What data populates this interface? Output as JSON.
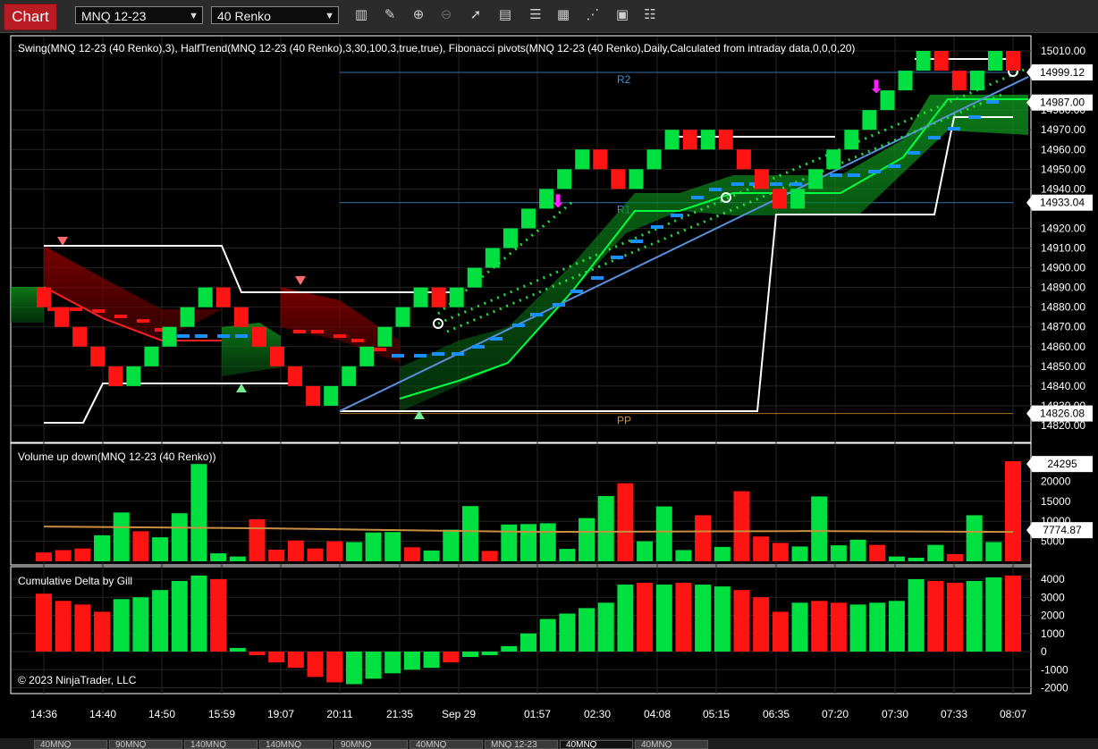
{
  "window": {
    "tab_label": "Chart",
    "instrument": "MNQ 12-23",
    "period": "40 Renko"
  },
  "toolbar_icons": [
    "bar-type-icon",
    "draw-pencil-icon",
    "zoom-in-icon",
    "zoom-out-icon",
    "pointer-icon",
    "data-box-icon",
    "properties-icon",
    "indicators-icon",
    "strategies-icon",
    "templates-icon",
    "list-icon"
  ],
  "panels": {
    "price": {
      "label": "Swing(MNQ 12-23 (40 Renko),3), HalfTrend(MNQ 12-23 (40 Renko),3,30,100,3,true,true), Fibonacci pivots(MNQ 12-23 (40 Renko),Daily,Calculated from intraday data,0,0,0,20)",
      "ticks": [
        "15010.00",
        "14980.00",
        "14970.00",
        "14960.00",
        "14950.00",
        "14940.00",
        "14920.00",
        "14910.00",
        "14900.00",
        "14890.00",
        "14880.00",
        "14870.00",
        "14860.00",
        "14850.00",
        "14840.00",
        "14830.00",
        "14820.00"
      ],
      "price_flags": [
        {
          "text": "14999.12",
          "color": "#ffffff",
          "value": 14999.12
        },
        {
          "text": "14987.00",
          "color": "#ffffff",
          "value": 14987.0
        },
        {
          "text": "14933.04",
          "color": "#ffffff",
          "value": 14933.04
        },
        {
          "text": "14826.08",
          "color": "#ffffff",
          "value": 14826.08
        }
      ],
      "pivot_labels": [
        {
          "text": "R2",
          "color": "#3f8fd8",
          "value": 14999.12
        },
        {
          "text": "R1",
          "color": "#3f8fd8",
          "value": 14933.04
        },
        {
          "text": "PP",
          "color": "#d89030",
          "value": 14826.08
        }
      ]
    },
    "volume": {
      "label": "Volume up down(MNQ 12-23 (40 Renko))",
      "ticks": [
        "20000",
        "15000",
        "10000",
        "5000"
      ],
      "flags": [
        {
          "text": "24295",
          "value": 24295
        },
        {
          "text": "7774.87",
          "value": 7774.87
        }
      ]
    },
    "delta": {
      "label": "Cumulative Delta by Gill",
      "ticks": [
        "4000",
        "3000",
        "2000",
        "1000",
        "0",
        "-1000",
        "-2000"
      ],
      "copyright": "© 2023 NinjaTrader, LLC"
    }
  },
  "time_axis": [
    "14:36",
    "14:40",
    "14:50",
    "15:59",
    "19:07",
    "20:11",
    "21:35",
    "Sep 29",
    "01:57",
    "02:30",
    "04:08",
    "05:15",
    "06:35",
    "07:20",
    "07:30",
    "07:33",
    "08:07"
  ],
  "chart_data": {
    "type": "bar",
    "title": "",
    "price_range": [
      14815,
      15015
    ],
    "bricks": {
      "close": [
        14880,
        14870,
        14860,
        14850,
        14840,
        14850,
        14860,
        14870,
        14880,
        14890,
        14880,
        14870,
        14860,
        14850,
        14840,
        14830,
        14840,
        14850,
        14860,
        14870,
        14880,
        14890,
        14880,
        14890,
        14900,
        14910,
        14920,
        14930,
        14940,
        14950,
        14960,
        14950,
        14940,
        14950,
        14960,
        14970,
        14960,
        14970,
        14960,
        14950,
        14940,
        14930,
        14940,
        14950,
        14960,
        14970,
        14980,
        14990,
        15000,
        15010,
        15000,
        14990,
        15000,
        15010,
        15000
      ],
      "up": [
        false,
        false,
        false,
        false,
        false,
        true,
        true,
        true,
        true,
        true,
        false,
        false,
        false,
        false,
        false,
        false,
        true,
        true,
        true,
        true,
        true,
        true,
        false,
        true,
        true,
        true,
        true,
        true,
        true,
        true,
        true,
        false,
        false,
        true,
        true,
        true,
        false,
        true,
        false,
        false,
        false,
        false,
        true,
        true,
        true,
        true,
        true,
        true,
        true,
        true,
        false,
        false,
        true,
        true,
        false
      ]
    },
    "volume": {
      "values": [
        2200,
        2800,
        3200,
        6500,
        12200,
        7500,
        6000,
        12000,
        24295,
        2000,
        1200,
        10500,
        2900,
        5200,
        3200,
        5000,
        4800,
        7200,
        7300,
        3500,
        2700,
        7900,
        13800,
        2600,
        9200,
        9300,
        9500,
        3100,
        10800,
        16300,
        19500,
        5000,
        13700,
        2800,
        11500,
        3600,
        17500,
        6200,
        4600,
        3700,
        16200,
        4000,
        5400,
        4100,
        1200,
        900,
        4100,
        1800,
        11500,
        4800,
        25000
      ],
      "up": [
        false,
        false,
        false,
        true,
        true,
        false,
        true,
        true,
        true,
        true,
        true,
        false,
        false,
        false,
        false,
        false,
        true,
        true,
        true,
        false,
        true,
        true,
        true,
        false,
        true,
        true,
        true,
        true,
        true,
        true,
        false,
        true,
        true,
        true,
        false,
        true,
        false,
        false,
        false,
        true,
        true,
        true,
        true,
        false,
        true,
        true,
        true,
        false,
        true,
        true,
        false
      ],
      "average": 7774.87
    },
    "cumulative_delta": {
      "values": [
        3200,
        2800,
        2600,
        2200,
        2900,
        3000,
        3400,
        3900,
        4200,
        4000,
        200,
        -200,
        -600,
        -900,
        -1400,
        -1700,
        -1800,
        -1500,
        -1200,
        -1000,
        -900,
        -600,
        -300,
        -200,
        300,
        1000,
        1800,
        2100,
        2400,
        2700,
        3700,
        3800,
        3700,
        3800,
        3700,
        3600,
        3400,
        3000,
        2200,
        2700,
        2800,
        2700,
        2600,
        2700,
        2800,
        4000,
        3900,
        3800,
        3900,
        4100,
        4200
      ],
      "up": [
        false,
        false,
        false,
        false,
        true,
        true,
        true,
        true,
        true,
        false,
        true,
        false,
        false,
        false,
        false,
        false,
        true,
        true,
        true,
        true,
        true,
        false,
        true,
        true,
        true,
        true,
        true,
        true,
        true,
        true,
        true,
        false,
        true,
        false,
        true,
        true,
        false,
        false,
        false,
        true,
        false,
        false,
        true,
        true,
        true,
        true,
        false,
        false,
        true,
        true,
        false
      ]
    },
    "colors": {
      "up": "#00e040",
      "down": "#ff1414",
      "avg_line": "#c89040",
      "trend_band_bear": "#8b0000",
      "trend_band_bull": "#0a7a1a",
      "swing": "#ffffff",
      "halftrend_dash": "#1a90ff"
    }
  },
  "bottom_tabs": [
    "40MNQ",
    "90MNQ",
    "140MNQ",
    "140MNQ",
    "90MNQ",
    "40MNQ",
    "MNQ 12-23",
    "40MNQ",
    "40MNQ"
  ]
}
